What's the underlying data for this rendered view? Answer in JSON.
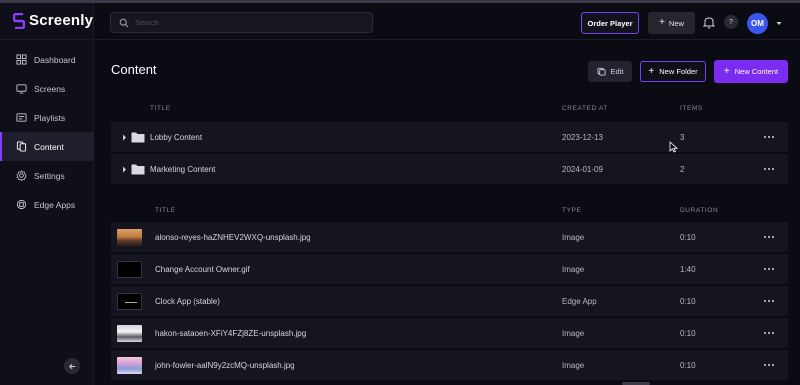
{
  "app": {
    "name": "Screenly",
    "brand_color": "#8b3dff"
  },
  "sidebar": {
    "items": [
      {
        "label": "Dashboard",
        "icon": "dashboard-icon",
        "active": false
      },
      {
        "label": "Screens",
        "icon": "monitor-icon",
        "active": false
      },
      {
        "label": "Playlists",
        "icon": "playlist-icon",
        "active": false
      },
      {
        "label": "Content",
        "icon": "files-icon",
        "active": true
      },
      {
        "label": "Settings",
        "icon": "gear-icon",
        "active": false
      },
      {
        "label": "Edge Apps",
        "icon": "edge-apps-icon",
        "active": false
      }
    ],
    "collapse_icon": "arrow-left-icon"
  },
  "header": {
    "search_placeholder": "Search",
    "order_player_label": "Order Player",
    "new_label": "New",
    "help_label": "?",
    "avatar_initials": "OM"
  },
  "main": {
    "title": "Content",
    "edit_label": "Edit",
    "new_folder_label": "New Folder",
    "new_content_label": "New Content"
  },
  "folders": {
    "columns": [
      "TITLE",
      "CREATED AT",
      "ITEMS"
    ],
    "rows": [
      {
        "title": "Lobby Content",
        "created_at": "2023-12-13",
        "items": "3"
      },
      {
        "title": "Marketing Content",
        "created_at": "2024-01-09",
        "items": "2"
      }
    ]
  },
  "content": {
    "columns": [
      "TITLE",
      "TYPE",
      "DURATION"
    ],
    "rows": [
      {
        "title": "alonso-reyes-haZNHEV2WXQ-unsplash.jpg",
        "type": "Image",
        "duration": "0:10"
      },
      {
        "title": "Change Account Owner.gif",
        "type": "Image",
        "duration": "1:40"
      },
      {
        "title": "Clock App (stable)",
        "type": "Edge App",
        "duration": "0:10"
      },
      {
        "title": "hakon-sataoen-XFiY4FZj8ZE-unsplash.jpg",
        "type": "Image",
        "duration": "0:10"
      },
      {
        "title": "john-fowler-aalN9y2zcMQ-unsplash.jpg",
        "type": "Image",
        "duration": "0:10"
      }
    ]
  }
}
